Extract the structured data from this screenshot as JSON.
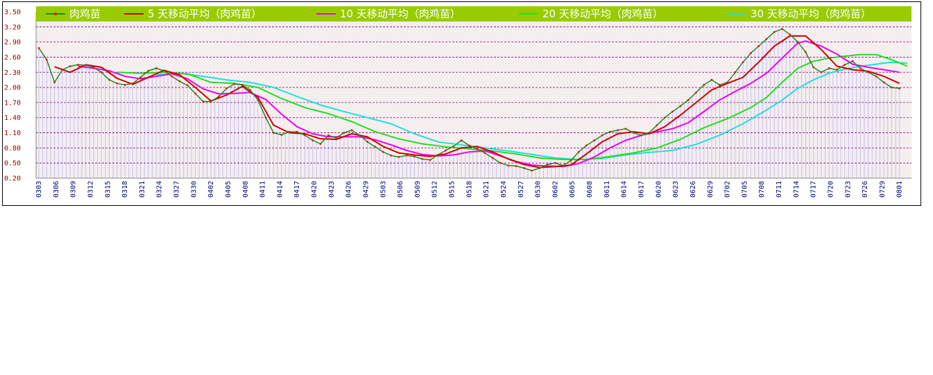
{
  "chart_data": {
    "type": "line",
    "title": "",
    "xlabel": "",
    "ylabel": "",
    "ylim": [
      0.2,
      3.5
    ],
    "yticks": [
      "3.50",
      "3.20",
      "2.90",
      "2.60",
      "2.30",
      "2.00",
      "1.70",
      "1.40",
      "1.10",
      "0.80",
      "0.50",
      "0.20"
    ],
    "xtick_labels": [
      "0303",
      "0306",
      "0309",
      "0312",
      "0315",
      "0318",
      "0321",
      "0324",
      "0327",
      "0330",
      "0402",
      "0405",
      "0408",
      "0411",
      "0414",
      "0417",
      "0420",
      "0423",
      "0426",
      "0429",
      "0503",
      "0506",
      "0509",
      "0512",
      "0515",
      "0518",
      "0521",
      "0524",
      "0527",
      "0530",
      "0602",
      "0605",
      "0608",
      "0611",
      "0614",
      "0617",
      "0620",
      "0623",
      "0626",
      "0629",
      "0702",
      "0705",
      "0708",
      "0711",
      "0714",
      "0717",
      "0720",
      "0723",
      "0726",
      "0729",
      "0801"
    ],
    "grid": true,
    "legend_position": "top",
    "colors": {
      "legend_band": "#99cc00",
      "grid_line": "#800080",
      "area_fill": "#c8c0f0",
      "series_main": "#1e8a1e",
      "series_ma5": "#cc0000",
      "series_ma10": "#ee00ee",
      "series_ma20": "#22dd22",
      "series_ma30": "#22dddd"
    },
    "series": [
      {
        "name": "肉鸡苗",
        "key": "main",
        "points": [
          [
            0,
            2.78
          ],
          [
            2,
            2.55
          ],
          [
            4,
            2.1
          ],
          [
            6,
            2.35
          ],
          [
            8,
            2.42
          ],
          [
            10,
            2.45
          ],
          [
            12,
            2.44
          ],
          [
            14,
            2.4
          ],
          [
            16,
            2.3
          ],
          [
            18,
            2.15
          ],
          [
            20,
            2.08
          ],
          [
            22,
            2.05
          ],
          [
            24,
            2.08
          ],
          [
            26,
            2.2
          ],
          [
            28,
            2.33
          ],
          [
            30,
            2.38
          ],
          [
            32,
            2.33
          ],
          [
            34,
            2.22
          ],
          [
            36,
            2.12
          ],
          [
            38,
            2.04
          ],
          [
            40,
            1.88
          ],
          [
            42,
            1.72
          ],
          [
            44,
            1.72
          ],
          [
            46,
            1.82
          ],
          [
            48,
            1.98
          ],
          [
            50,
            2.07
          ],
          [
            52,
            2.05
          ],
          [
            54,
            1.95
          ],
          [
            56,
            1.75
          ],
          [
            58,
            1.4
          ],
          [
            60,
            1.1
          ],
          [
            62,
            1.06
          ],
          [
            64,
            1.12
          ],
          [
            66,
            1.12
          ],
          [
            68,
            1.05
          ],
          [
            70,
            0.95
          ],
          [
            72,
            0.88
          ],
          [
            74,
            1.05
          ],
          [
            76,
            1.0
          ],
          [
            78,
            1.1
          ],
          [
            80,
            1.15
          ],
          [
            82,
            1.05
          ],
          [
            84,
            0.92
          ],
          [
            86,
            0.82
          ],
          [
            88,
            0.72
          ],
          [
            90,
            0.65
          ],
          [
            92,
            0.62
          ],
          [
            94,
            0.65
          ],
          [
            96,
            0.63
          ],
          [
            98,
            0.58
          ],
          [
            100,
            0.56
          ],
          [
            102,
            0.66
          ],
          [
            104,
            0.75
          ],
          [
            106,
            0.83
          ],
          [
            108,
            0.95
          ],
          [
            110,
            0.85
          ],
          [
            112,
            0.78
          ],
          [
            114,
            0.7
          ],
          [
            116,
            0.6
          ],
          [
            118,
            0.5
          ],
          [
            120,
            0.45
          ],
          [
            122,
            0.44
          ],
          [
            124,
            0.4
          ],
          [
            126,
            0.35
          ],
          [
            128,
            0.4
          ],
          [
            130,
            0.47
          ],
          [
            132,
            0.5
          ],
          [
            134,
            0.45
          ],
          [
            136,
            0.55
          ],
          [
            138,
            0.72
          ],
          [
            140,
            0.85
          ],
          [
            142,
            0.95
          ],
          [
            144,
            1.05
          ],
          [
            146,
            1.12
          ],
          [
            148,
            1.15
          ],
          [
            150,
            1.18
          ],
          [
            152,
            1.1
          ],
          [
            154,
            1.05
          ],
          [
            156,
            1.1
          ],
          [
            158,
            1.25
          ],
          [
            160,
            1.4
          ],
          [
            162,
            1.52
          ],
          [
            164,
            1.63
          ],
          [
            166,
            1.75
          ],
          [
            168,
            1.9
          ],
          [
            170,
            2.05
          ],
          [
            172,
            2.15
          ],
          [
            174,
            2.05
          ],
          [
            176,
            2.1
          ],
          [
            178,
            2.3
          ],
          [
            180,
            2.5
          ],
          [
            182,
            2.68
          ],
          [
            184,
            2.82
          ],
          [
            186,
            2.96
          ],
          [
            188,
            3.1
          ],
          [
            190,
            3.16
          ],
          [
            192,
            3.05
          ],
          [
            194,
            2.9
          ],
          [
            196,
            2.7
          ],
          [
            198,
            2.4
          ],
          [
            200,
            2.3
          ],
          [
            202,
            2.38
          ],
          [
            204,
            2.35
          ],
          [
            206,
            2.45
          ],
          [
            208,
            2.52
          ],
          [
            210,
            2.38
          ],
          [
            212,
            2.3
          ],
          [
            214,
            2.22
          ],
          [
            216,
            2.1
          ],
          [
            218,
            2.0
          ],
          [
            220,
            1.98
          ]
        ]
      },
      {
        "name": "5 天移动平均（肉鸡苗）",
        "key": "ma5",
        "points": [
          [
            4,
            2.41
          ],
          [
            8,
            2.3
          ],
          [
            12,
            2.45
          ],
          [
            16,
            2.4
          ],
          [
            20,
            2.18
          ],
          [
            24,
            2.06
          ],
          [
            28,
            2.2
          ],
          [
            32,
            2.34
          ],
          [
            36,
            2.25
          ],
          [
            40,
            2.0
          ],
          [
            44,
            1.73
          ],
          [
            48,
            1.85
          ],
          [
            52,
            2.02
          ],
          [
            56,
            1.8
          ],
          [
            60,
            1.25
          ],
          [
            64,
            1.1
          ],
          [
            68,
            1.08
          ],
          [
            72,
            0.98
          ],
          [
            76,
            0.97
          ],
          [
            80,
            1.08
          ],
          [
            84,
            1.02
          ],
          [
            88,
            0.83
          ],
          [
            92,
            0.7
          ],
          [
            96,
            0.66
          ],
          [
            100,
            0.63
          ],
          [
            104,
            0.68
          ],
          [
            108,
            0.8
          ],
          [
            112,
            0.83
          ],
          [
            116,
            0.72
          ],
          [
            120,
            0.58
          ],
          [
            124,
            0.47
          ],
          [
            128,
            0.41
          ],
          [
            132,
            0.43
          ],
          [
            136,
            0.46
          ],
          [
            140,
            0.68
          ],
          [
            144,
            0.92
          ],
          [
            148,
            1.08
          ],
          [
            152,
            1.12
          ],
          [
            156,
            1.08
          ],
          [
            160,
            1.22
          ],
          [
            164,
            1.45
          ],
          [
            168,
            1.7
          ],
          [
            172,
            1.95
          ],
          [
            176,
            2.08
          ],
          [
            180,
            2.2
          ],
          [
            184,
            2.5
          ],
          [
            188,
            2.82
          ],
          [
            192,
            3.02
          ],
          [
            196,
            3.02
          ],
          [
            200,
            2.75
          ],
          [
            204,
            2.42
          ],
          [
            208,
            2.35
          ],
          [
            212,
            2.32
          ],
          [
            216,
            2.22
          ],
          [
            220,
            2.08
          ]
        ]
      },
      {
        "name": "10 天移动平均（肉鸡苗）",
        "key": "ma10",
        "points": [
          [
            10,
            2.42
          ],
          [
            14,
            2.38
          ],
          [
            18,
            2.33
          ],
          [
            22,
            2.22
          ],
          [
            26,
            2.17
          ],
          [
            30,
            2.22
          ],
          [
            34,
            2.27
          ],
          [
            38,
            2.17
          ],
          [
            42,
            1.97
          ],
          [
            46,
            1.87
          ],
          [
            50,
            1.88
          ],
          [
            54,
            1.9
          ],
          [
            58,
            1.76
          ],
          [
            62,
            1.47
          ],
          [
            66,
            1.22
          ],
          [
            70,
            1.08
          ],
          [
            74,
            1.02
          ],
          [
            78,
            1.02
          ],
          [
            82,
            1.02
          ],
          [
            86,
            0.96
          ],
          [
            90,
            0.86
          ],
          [
            94,
            0.75
          ],
          [
            98,
            0.67
          ],
          [
            102,
            0.64
          ],
          [
            106,
            0.66
          ],
          [
            110,
            0.72
          ],
          [
            114,
            0.74
          ],
          [
            118,
            0.64
          ],
          [
            122,
            0.53
          ],
          [
            126,
            0.46
          ],
          [
            130,
            0.44
          ],
          [
            134,
            0.43
          ],
          [
            138,
            0.49
          ],
          [
            142,
            0.62
          ],
          [
            146,
            0.8
          ],
          [
            150,
            0.95
          ],
          [
            154,
            1.05
          ],
          [
            158,
            1.12
          ],
          [
            162,
            1.18
          ],
          [
            166,
            1.3
          ],
          [
            170,
            1.52
          ],
          [
            174,
            1.75
          ],
          [
            178,
            1.92
          ],
          [
            182,
            2.08
          ],
          [
            186,
            2.28
          ],
          [
            190,
            2.58
          ],
          [
            194,
            2.88
          ],
          [
            196,
            2.92
          ],
          [
            200,
            2.82
          ],
          [
            204,
            2.66
          ],
          [
            208,
            2.46
          ],
          [
            212,
            2.4
          ],
          [
            216,
            2.35
          ],
          [
            220,
            2.3
          ]
        ]
      },
      {
        "name": "20 天移动平均（肉鸡苗）",
        "key": "ma20",
        "points": [
          [
            20,
            2.3
          ],
          [
            26,
            2.28
          ],
          [
            32,
            2.3
          ],
          [
            38,
            2.27
          ],
          [
            44,
            2.1
          ],
          [
            50,
            2.08
          ],
          [
            56,
            2.0
          ],
          [
            62,
            1.78
          ],
          [
            68,
            1.6
          ],
          [
            74,
            1.48
          ],
          [
            80,
            1.32
          ],
          [
            86,
            1.12
          ],
          [
            92,
            0.98
          ],
          [
            98,
            0.88
          ],
          [
            104,
            0.82
          ],
          [
            110,
            0.78
          ],
          [
            116,
            0.74
          ],
          [
            122,
            0.68
          ],
          [
            128,
            0.6
          ],
          [
            134,
            0.57
          ],
          [
            140,
            0.57
          ],
          [
            146,
            0.63
          ],
          [
            152,
            0.7
          ],
          [
            158,
            0.8
          ],
          [
            164,
            0.97
          ],
          [
            170,
            1.2
          ],
          [
            176,
            1.38
          ],
          [
            182,
            1.6
          ],
          [
            186,
            1.8
          ],
          [
            190,
            2.1
          ],
          [
            194,
            2.38
          ],
          [
            198,
            2.52
          ],
          [
            202,
            2.58
          ],
          [
            206,
            2.62
          ],
          [
            210,
            2.65
          ],
          [
            214,
            2.65
          ],
          [
            218,
            2.55
          ],
          [
            222,
            2.42
          ]
        ]
      },
      {
        "name": "30 天移动平均（肉鸡苗）",
        "key": "ma30",
        "points": [
          [
            30,
            2.25
          ],
          [
            36,
            2.28
          ],
          [
            42,
            2.22
          ],
          [
            48,
            2.15
          ],
          [
            54,
            2.1
          ],
          [
            60,
            2.0
          ],
          [
            66,
            1.82
          ],
          [
            72,
            1.65
          ],
          [
            78,
            1.52
          ],
          [
            84,
            1.4
          ],
          [
            90,
            1.28
          ],
          [
            96,
            1.08
          ],
          [
            102,
            0.92
          ],
          [
            108,
            0.86
          ],
          [
            114,
            0.8
          ],
          [
            120,
            0.74
          ],
          [
            126,
            0.67
          ],
          [
            132,
            0.6
          ],
          [
            138,
            0.57
          ],
          [
            144,
            0.59
          ],
          [
            150,
            0.66
          ],
          [
            156,
            0.71
          ],
          [
            162,
            0.75
          ],
          [
            168,
            0.87
          ],
          [
            174,
            1.05
          ],
          [
            180,
            1.28
          ],
          [
            186,
            1.55
          ],
          [
            190,
            1.75
          ],
          [
            194,
            1.98
          ],
          [
            198,
            2.15
          ],
          [
            202,
            2.28
          ],
          [
            206,
            2.36
          ],
          [
            210,
            2.42
          ],
          [
            214,
            2.46
          ],
          [
            218,
            2.5
          ],
          [
            222,
            2.48
          ]
        ]
      }
    ]
  }
}
